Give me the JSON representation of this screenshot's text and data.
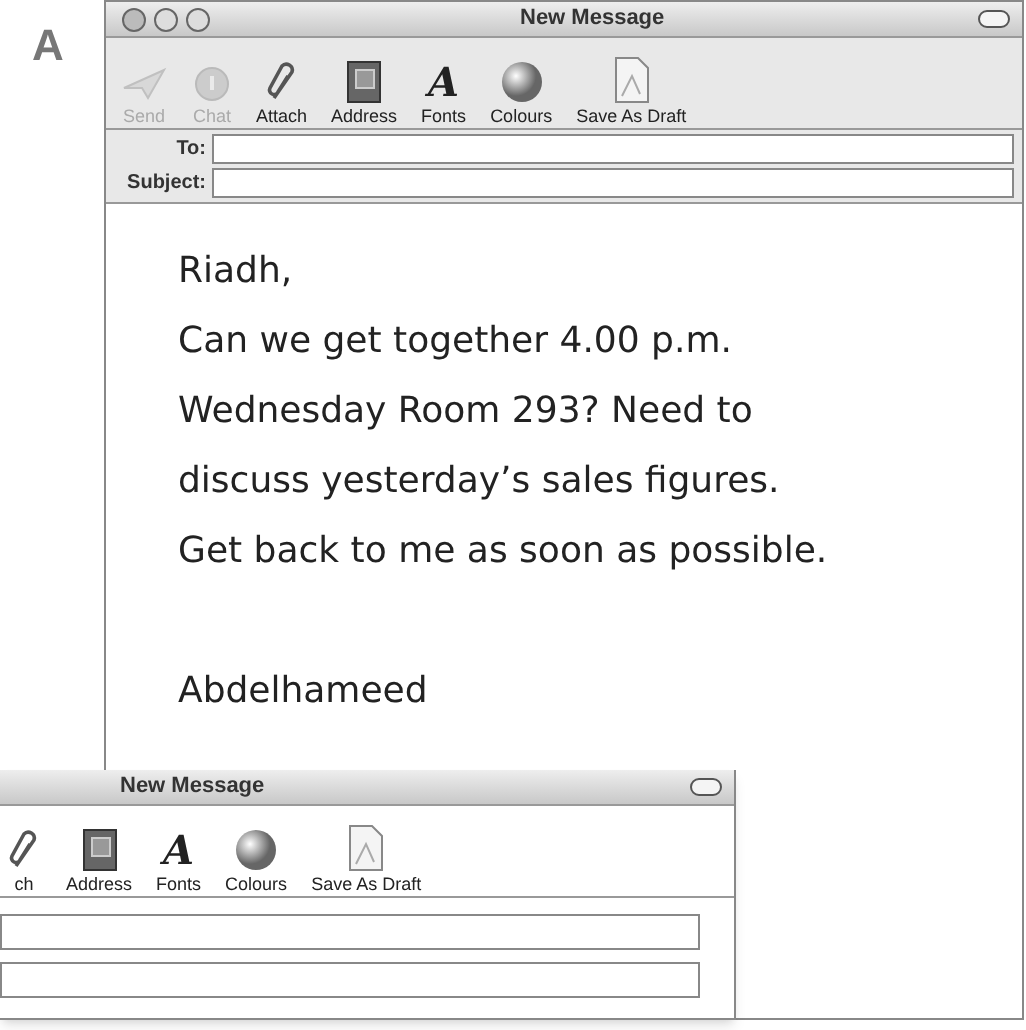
{
  "figure_label": "A",
  "window": {
    "title": "New Message",
    "toolbar": [
      {
        "kind": "send",
        "label": "Send",
        "disabled": true
      },
      {
        "kind": "chat",
        "label": "Chat",
        "disabled": true
      },
      {
        "kind": "attach",
        "label": "Attach",
        "disabled": false
      },
      {
        "kind": "address",
        "label": "Address",
        "disabled": false
      },
      {
        "kind": "fonts",
        "label": "Fonts",
        "glyph": "A",
        "disabled": false
      },
      {
        "kind": "colours",
        "label": "Colours",
        "disabled": false
      },
      {
        "kind": "draft",
        "label": "Save As Draft",
        "disabled": false
      }
    ],
    "fields": [
      {
        "label": "To:"
      },
      {
        "label": "Subject:"
      }
    ],
    "paragraphs": [
      [
        "Riadh,",
        "Can we get together 4.00 p.m.",
        "Wednesday Room 293? Need to",
        "discuss yesterday’s sales figures.",
        "Get back to me as soon as possible."
      ],
      [
        "Abdelhameed"
      ]
    ]
  },
  "second_window": {
    "title": "New Message",
    "toolbar": [
      {
        "kind": "attach",
        "label": "ch",
        "disabled": false
      },
      {
        "kind": "address",
        "label": "Address",
        "disabled": false
      },
      {
        "kind": "fonts",
        "label": "Fonts",
        "glyph": "A",
        "disabled": false
      },
      {
        "kind": "colours",
        "label": "Colours",
        "disabled": false
      },
      {
        "kind": "draft",
        "label": "Save As Draft",
        "disabled": false
      }
    ],
    "fields": [
      {
        "kind": "input"
      },
      {
        "kind": "input"
      }
    ]
  }
}
